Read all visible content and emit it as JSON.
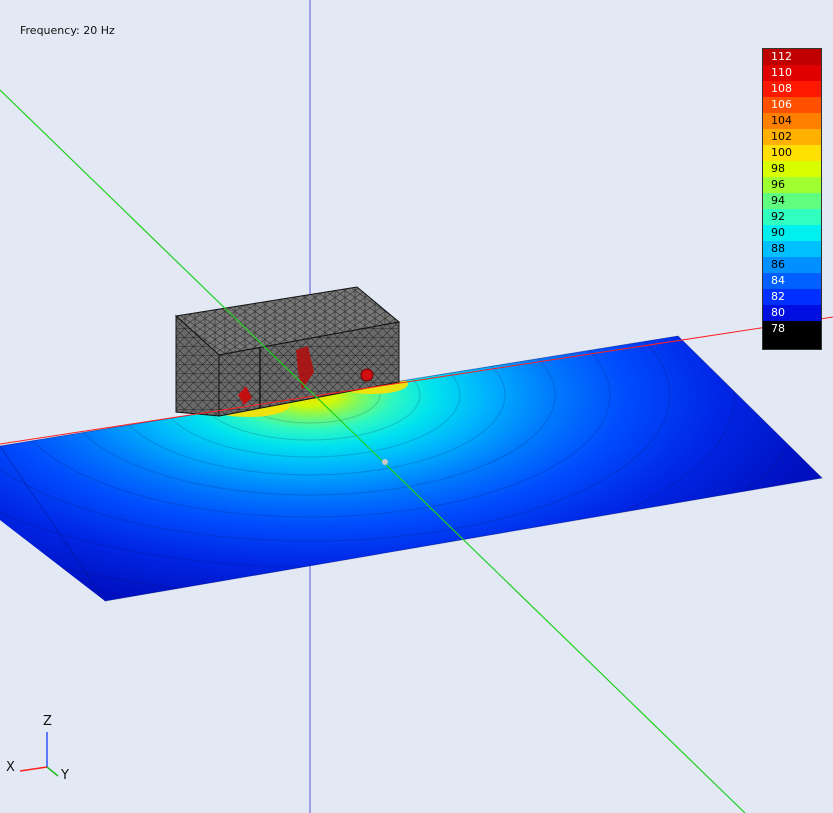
{
  "overlay": {
    "frequency_text": "Frequency: 20 Hz"
  },
  "legend": {
    "labels": [
      "112",
      "110",
      "108",
      "106",
      "104",
      "102",
      "100",
      "98",
      "96",
      "94",
      "92",
      "90",
      "88",
      "86",
      "84",
      "82",
      "80",
      "78"
    ],
    "colors": [
      "#c00000",
      "#e00000",
      "#ff1800",
      "#ff5000",
      "#ff8000",
      "#ffb000",
      "#ffe000",
      "#d8ff00",
      "#a0ff30",
      "#60ff80",
      "#30ffc0",
      "#00f0f0",
      "#00c0ff",
      "#0090ff",
      "#0060ff",
      "#0030ff",
      "#0010e0",
      "#000000"
    ],
    "text_colors": [
      "#ffffff",
      "#ffffff",
      "#ffffff",
      "#ffffff",
      "#000000",
      "#000000",
      "#000000",
      "#000000",
      "#000000",
      "#000000",
      "#000000",
      "#000000",
      "#000000",
      "#000000",
      "#ffffff",
      "#ffffff",
      "#ffffff",
      "#ffffff"
    ]
  },
  "triad": {
    "z": "Z",
    "x": "X",
    "y": "Y"
  },
  "colors": {
    "background": "#e2e9f4",
    "x_axis": "#ff2020",
    "y_axis": "#20d020",
    "z_axis": "#7070e0",
    "plane_base": "#0018c8",
    "hotspot": "#ffe000"
  }
}
